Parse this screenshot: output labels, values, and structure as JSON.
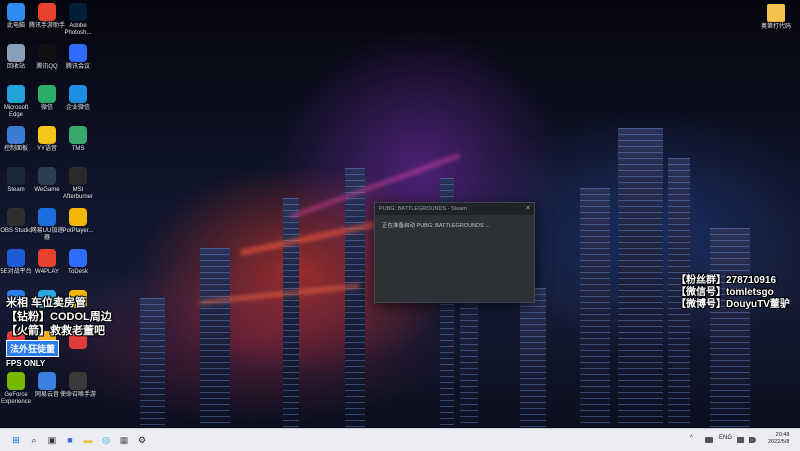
{
  "desktop": {
    "icons_col1": [
      {
        "label": "此电脑",
        "icon": "computer-icon",
        "color": "#2d8cf0"
      },
      {
        "label": "回收站",
        "icon": "recycle-bin-icon",
        "color": "#8aa0b8"
      },
      {
        "label": "Microsoft Edge",
        "icon": "edge-icon",
        "color": "#1fa2d8"
      },
      {
        "label": "控制面板",
        "icon": "control-panel-icon",
        "color": "#3a7bd5"
      },
      {
        "label": "Steam",
        "icon": "steam-icon",
        "color": "#1b2838"
      },
      {
        "label": "OBS Studio",
        "icon": "obs-icon",
        "color": "#302e31"
      },
      {
        "label": "5E对战平台",
        "icon": "5e-icon",
        "color": "#1e5bd6"
      },
      {
        "label": "",
        "icon": "app-icon",
        "color": "#2b7de9"
      },
      {
        "label": "",
        "icon": "app-icon",
        "color": "#e23b3b"
      },
      {
        "label": "GeForce Experience",
        "icon": "geforce-icon",
        "color": "#76b900"
      }
    ],
    "icons_col2": [
      {
        "label": "腾讯手游助手",
        "icon": "tencent-game-icon",
        "color": "#e8412c"
      },
      {
        "label": "腾讯QQ",
        "icon": "qq-icon",
        "color": "#111111"
      },
      {
        "label": "微信",
        "icon": "wechat-icon",
        "color": "#2aae67"
      },
      {
        "label": "YY语音",
        "icon": "yy-icon",
        "color": "#f5c518"
      },
      {
        "label": "WeGame",
        "icon": "wegame-icon",
        "color": "#2c3e50"
      },
      {
        "label": "网易UU加速器",
        "icon": "uu-icon",
        "color": "#1d6fe0"
      },
      {
        "label": "W4PLAY",
        "icon": "w4play-icon",
        "color": "#e8412c"
      },
      {
        "label": "",
        "icon": "app-icon",
        "color": "#2aa8e0"
      },
      {
        "label": "",
        "icon": "app-icon",
        "color": "#e8b020"
      },
      {
        "label": "网易云音",
        "icon": "cloud-music-icon",
        "color": "#3b7fe0"
      }
    ],
    "icons_col3": [
      {
        "label": "Adobe Photosh...",
        "icon": "photoshop-icon",
        "color": "#001e36"
      },
      {
        "label": "腾讯会议",
        "icon": "tencent-meeting-icon",
        "color": "#2f6bff"
      },
      {
        "label": "企业微信",
        "icon": "wecom-icon",
        "color": "#1e8fe0"
      },
      {
        "label": "TMS",
        "icon": "tms-icon",
        "color": "#3aa76d"
      },
      {
        "label": "MSI Afterburner",
        "icon": "afterburner-icon",
        "color": "#2a2a2a"
      },
      {
        "label": "PotPlayer...",
        "icon": "potplayer-icon",
        "color": "#f2b705"
      },
      {
        "label": "ToDesk",
        "icon": "todesk-icon",
        "color": "#2f6bff"
      },
      {
        "label": "",
        "icon": "app-icon",
        "color": "#f2b705"
      },
      {
        "label": "",
        "icon": "app-icon",
        "color": "#e23b3b"
      },
      {
        "label": "使命召唤手游",
        "icon": "cod-icon",
        "color": "#3a3a3a"
      }
    ],
    "right_icon": {
      "label": "奥第打代码",
      "icon": "folder-icon",
      "color": "#f2c14e"
    }
  },
  "dialog": {
    "title": "PUBG: BATTLEGROUNDS - Steam",
    "message": "正在准备启动 PUBG: BATTLEGROUNDS ...",
    "close_glyph": "×"
  },
  "overlay_left": {
    "line1": "米相 车位卖房管",
    "line2": "【钻粉】CODOL周边",
    "line3": "【火箭】救救老董吧",
    "badge": "法外狂徒董",
    "badge2": "FPS ONLY"
  },
  "overlay_right": {
    "fans_group": "【粉丝群】278710916",
    "wechat": "【微信号】tomletsgo",
    "weibo": "【微博号】DouyuTV董驴"
  },
  "taskbar": {
    "apps": [
      {
        "name": "start-icon",
        "glyph": "⊞",
        "color": "#1e6fe0"
      },
      {
        "name": "search-icon",
        "glyph": "⌕",
        "color": "#333333"
      },
      {
        "name": "task-view-icon",
        "glyph": "▣",
        "color": "#333333"
      },
      {
        "name": "taskbar-app-icon",
        "glyph": "■",
        "color": "#3a6bd5"
      },
      {
        "name": "file-explorer-icon",
        "glyph": "▬",
        "color": "#f2c14e"
      },
      {
        "name": "edge-icon",
        "glyph": "◎",
        "color": "#1fa2d8"
      },
      {
        "name": "store-icon",
        "glyph": "▦",
        "color": "#555555"
      },
      {
        "name": "steam-icon",
        "glyph": "⚙",
        "color": "#1b2838"
      }
    ],
    "tray": {
      "chevron": "^",
      "lang": "ENG",
      "time": "20:48",
      "date": "2022/5/8"
    }
  },
  "colors": {
    "taskbar_bg": "#ecedf2",
    "dialog_bg": "#2d3136",
    "accent": "#2b7de9"
  }
}
